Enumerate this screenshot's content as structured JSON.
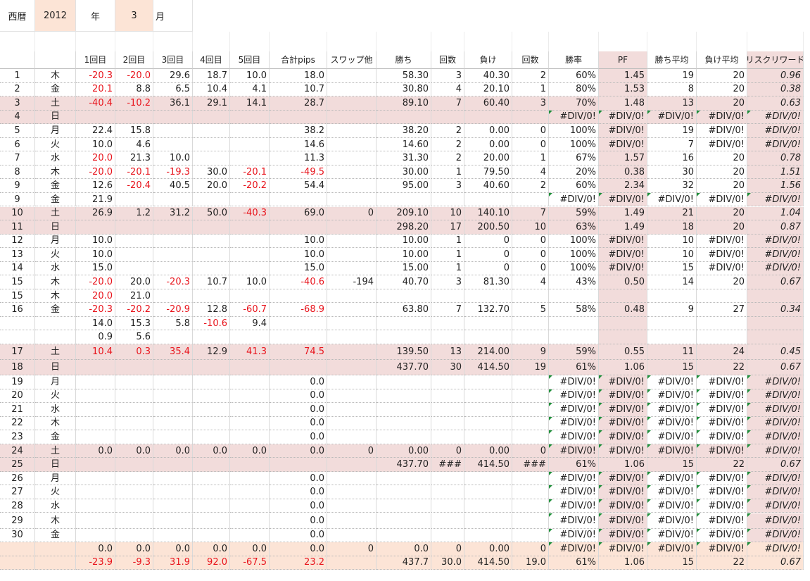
{
  "header": {
    "era_label": "西暦",
    "year": "2012",
    "year_unit": "年",
    "month": "3",
    "month_unit": "月"
  },
  "columns": [
    "",
    "",
    "1回目",
    "2回目",
    "3回目",
    "4回目",
    "5回目",
    "合計pips",
    "スワップ他",
    "勝ち",
    "回数",
    "負け",
    "回数",
    "勝率",
    "PF",
    "勝ち平均",
    "負け平均",
    "リスクリワード"
  ],
  "rows": [
    {
      "day": "1",
      "dow": "木",
      "t": [
        "-20.3",
        "-20.0",
        "29.6",
        "18.7",
        "10.0"
      ],
      "red": [
        0,
        1
      ],
      "sum": "18.0",
      "swap": "",
      "win": "58.30",
      "wc": "3",
      "loss": "40.30",
      "lc": "2",
      "rate": "60%",
      "pf": "1.45",
      "wavg": "19",
      "lavg": "20",
      "rr": "0.96"
    },
    {
      "day": "2",
      "dow": "金",
      "t": [
        "20.1",
        "8.8",
        "6.5",
        "10.4",
        "4.1"
      ],
      "red": [
        0
      ],
      "sum": "10.7",
      "swap": "",
      "win": "30.80",
      "wc": "4",
      "loss": "20.10",
      "lc": "1",
      "rate": "80%",
      "pf": "1.53",
      "wavg": "8",
      "lavg": "20",
      "rr": "0.38"
    },
    {
      "day": "3",
      "dow": "土",
      "shade": 1,
      "t": [
        "-40.4",
        "-10.2",
        "36.1",
        "29.1",
        "14.1"
      ],
      "red": [
        0,
        1
      ],
      "sum": "28.7",
      "swap": "",
      "win": "89.10",
      "wc": "7",
      "loss": "60.40",
      "lc": "3",
      "rate": "70%",
      "pf": "1.48",
      "wavg": "13",
      "lavg": "20",
      "rr": "0.63"
    },
    {
      "day": "4",
      "dow": "日",
      "shade": 1,
      "t": [
        "",
        "",
        "",
        "",
        ""
      ],
      "sum": "",
      "swap": "",
      "win": "",
      "wc": "",
      "loss": "",
      "lc": "",
      "rate": "#DIV/0!",
      "pf": "#DIV/0!",
      "wavg": "#DIV/0!",
      "lavg": "#DIV/0!",
      "rr": "#DIV/0!",
      "err": 1
    },
    {
      "day": "5",
      "dow": "月",
      "t": [
        "22.4",
        "15.8",
        "",
        "",
        ""
      ],
      "sum": "38.2",
      "swap": "",
      "win": "38.20",
      "wc": "2",
      "loss": "0.00",
      "lc": "0",
      "rate": "100%",
      "pf": "#DIV/0!",
      "wavg": "19",
      "lavg": "#DIV/0!",
      "rr": "#DIV/0!"
    },
    {
      "day": "6",
      "dow": "火",
      "t": [
        "10.0",
        "4.6",
        "",
        "",
        ""
      ],
      "sum": "14.6",
      "swap": "",
      "win": "14.60",
      "wc": "2",
      "loss": "0.00",
      "lc": "0",
      "rate": "100%",
      "pf": "#DIV/0!",
      "wavg": "7",
      "lavg": "#DIV/0!",
      "rr": "#DIV/0!"
    },
    {
      "day": "7",
      "dow": "水",
      "t": [
        "20.0",
        "21.3",
        "10.0",
        "",
        ""
      ],
      "red": [
        0
      ],
      "sum": "11.3",
      "swap": "",
      "win": "31.30",
      "wc": "2",
      "loss": "20.00",
      "lc": "1",
      "rate": "67%",
      "pf": "1.57",
      "wavg": "16",
      "lavg": "20",
      "rr": "0.78"
    },
    {
      "day": "8",
      "dow": "木",
      "t": [
        "-20.0",
        "-20.1",
        "-19.3",
        "30.0",
        "-20.1"
      ],
      "red": [
        0,
        1,
        2,
        4
      ],
      "sumred": 1,
      "sum": "-49.5",
      "swap": "",
      "win": "30.00",
      "wc": "1",
      "loss": "79.50",
      "lc": "4",
      "rate": "20%",
      "pf": "0.38",
      "wavg": "30",
      "lavg": "20",
      "rr": "1.51"
    },
    {
      "day": "9",
      "dow": "金",
      "t": [
        "12.6",
        "-20.4",
        "40.5",
        "20.0",
        "-20.2"
      ],
      "red": [
        1,
        4
      ],
      "sum": "54.4",
      "swap": "",
      "win": "95.00",
      "wc": "3",
      "loss": "40.60",
      "lc": "2",
      "rate": "60%",
      "pf": "2.34",
      "wavg": "32",
      "lavg": "20",
      "rr": "1.56"
    },
    {
      "day": "9",
      "dow": "金",
      "t": [
        "21.9",
        "",
        "",
        "",
        ""
      ],
      "sum": "",
      "swap": "",
      "win": "",
      "wc": "",
      "loss": "",
      "lc": "",
      "rate": "#DIV/0!",
      "pf": "#DIV/0!",
      "wavg": "#DIV/0!",
      "lavg": "#DIV/0!",
      "rr": "#DIV/0!",
      "err": 1
    },
    {
      "day": "10",
      "dow": "土",
      "shade": 1,
      "t": [
        "26.9",
        "1.2",
        "31.2",
        "50.0",
        "-40.3"
      ],
      "red": [
        4
      ],
      "sum": "69.0",
      "swap": "0",
      "win": "209.10",
      "wc": "10",
      "loss": "140.10",
      "lc": "7",
      "rate": "59%",
      "pf": "1.49",
      "wavg": "21",
      "lavg": "20",
      "rr": "1.04"
    },
    {
      "day": "11",
      "dow": "日",
      "shade": 1,
      "t": [
        "",
        "",
        "",
        "",
        ""
      ],
      "sum": "",
      "swap": "",
      "win": "298.20",
      "wc": "17",
      "loss": "200.50",
      "lc": "10",
      "rate": "63%",
      "pf": "1.49",
      "wavg": "18",
      "lavg": "20",
      "rr": "0.87"
    },
    {
      "day": "12",
      "dow": "月",
      "t": [
        "10.0",
        "",
        "",
        "",
        ""
      ],
      "sum": "10.0",
      "swap": "",
      "win": "10.00",
      "wc": "1",
      "loss": "0",
      "lc": "0",
      "rate": "100%",
      "pf": "#DIV/0!",
      "wavg": "10",
      "lavg": "#DIV/0!",
      "rr": "#DIV/0!"
    },
    {
      "day": "13",
      "dow": "火",
      "t": [
        "10.0",
        "",
        "",
        "",
        ""
      ],
      "sum": "10.0",
      "swap": "",
      "win": "10.00",
      "wc": "1",
      "loss": "0",
      "lc": "0",
      "rate": "100%",
      "pf": "#DIV/0!",
      "wavg": "10",
      "lavg": "#DIV/0!",
      "rr": "#DIV/0!"
    },
    {
      "day": "14",
      "dow": "水",
      "t": [
        "15.0",
        "",
        "",
        "",
        ""
      ],
      "sum": "15.0",
      "swap": "",
      "win": "15.00",
      "wc": "1",
      "loss": "0",
      "lc": "0",
      "rate": "100%",
      "pf": "#DIV/0!",
      "wavg": "15",
      "lavg": "#DIV/0!",
      "rr": "#DIV/0!"
    },
    {
      "day": "15",
      "dow": "木",
      "t": [
        "-20.0",
        "20.0",
        "-20.3",
        "10.7",
        "10.0"
      ],
      "red": [
        0,
        2
      ],
      "sumred": 1,
      "sum": "-40.6",
      "swap": "-194",
      "win": "40.70",
      "wc": "3",
      "loss": "81.30",
      "lc": "4",
      "rate": "43%",
      "pf": "0.50",
      "wavg": "14",
      "lavg": "20",
      "rr": "0.67"
    },
    {
      "day": "15",
      "dow": "木",
      "t": [
        "20.0",
        "21.0",
        "",
        "",
        ""
      ],
      "red": [
        0
      ],
      "sum": "",
      "swap": "",
      "win": "",
      "wc": "",
      "loss": "",
      "lc": "",
      "rate": "",
      "pf": "",
      "wavg": "",
      "lavg": "",
      "rr": ""
    },
    {
      "day": "16",
      "dow": "金",
      "t": [
        "-20.3",
        "-20.2",
        "-20.9",
        "12.8",
        "-60.7"
      ],
      "red": [
        0,
        1,
        2,
        4
      ],
      "sumred": 1,
      "sum": "-68.9",
      "swap": "",
      "win": "63.80",
      "wc": "7",
      "loss": "132.70",
      "lc": "5",
      "rate": "58%",
      "pf": "0.48",
      "wavg": "9",
      "lavg": "27",
      "rr": "0.34"
    },
    {
      "day": "",
      "dow": "",
      "t": [
        "14.0",
        "15.3",
        "5.8",
        "-10.6",
        "9.4"
      ],
      "red": [
        3
      ],
      "sum": "",
      "swap": "",
      "win": "",
      "wc": "",
      "loss": "",
      "lc": "",
      "rate": "",
      "pf": "",
      "wavg": "",
      "lavg": "",
      "rr": ""
    },
    {
      "day": "",
      "dow": "",
      "t": [
        "0.9",
        "5.6",
        "",
        "",
        ""
      ],
      "sum": "",
      "swap": "",
      "win": "",
      "wc": "",
      "loss": "",
      "lc": "",
      "rate": "",
      "pf": "",
      "wavg": "",
      "lavg": "",
      "rr": ""
    },
    {
      "day": "17",
      "dow": "土",
      "shade": 1,
      "tall": 1,
      "t": [
        "10.4",
        "0.3",
        "35.4",
        "12.9",
        "41.3"
      ],
      "red": [
        0,
        1,
        2,
        4
      ],
      "sumred": 1,
      "sum": "74.5",
      "swap": "",
      "win": "139.50",
      "wc": "13",
      "loss": "214.00",
      "lc": "9",
      "rate": "59%",
      "pf": "0.55",
      "wavg": "11",
      "lavg": "24",
      "rr": "0.45"
    },
    {
      "day": "18",
      "dow": "日",
      "shade": 1,
      "tall": 1,
      "t": [
        "",
        "",
        "",
        "",
        ""
      ],
      "sum": "",
      "swap": "",
      "win": "437.70",
      "wc": "30",
      "loss": "414.50",
      "lc": "19",
      "rate": "61%",
      "pf": "1.06",
      "wavg": "15",
      "lavg": "22",
      "rr": "0.67"
    },
    {
      "day": "19",
      "dow": "月",
      "t": [
        "",
        "",
        "",
        "",
        ""
      ],
      "sum": "0.0",
      "swap": "",
      "win": "",
      "wc": "",
      "loss": "",
      "lc": "",
      "rate": "#DIV/0!",
      "pf": "#DIV/0!",
      "wavg": "#DIV/0!",
      "lavg": "#DIV/0!",
      "rr": "#DIV/0!",
      "err": 1
    },
    {
      "day": "20",
      "dow": "火",
      "t": [
        "",
        "",
        "",
        "",
        ""
      ],
      "sum": "0.0",
      "swap": "",
      "win": "",
      "wc": "",
      "loss": "",
      "lc": "",
      "rate": "#DIV/0!",
      "pf": "#DIV/0!",
      "wavg": "#DIV/0!",
      "lavg": "#DIV/0!",
      "rr": "#DIV/0!",
      "err": 1
    },
    {
      "day": "21",
      "dow": "水",
      "t": [
        "",
        "",
        "",
        "",
        ""
      ],
      "sum": "0.0",
      "swap": "",
      "win": "",
      "wc": "",
      "loss": "",
      "lc": "",
      "rate": "#DIV/0!",
      "pf": "#DIV/0!",
      "wavg": "#DIV/0!",
      "lavg": "#DIV/0!",
      "rr": "#DIV/0!",
      "err": 1
    },
    {
      "day": "22",
      "dow": "木",
      "t": [
        "",
        "",
        "",
        "",
        ""
      ],
      "sum": "0.0",
      "swap": "",
      "win": "",
      "wc": "",
      "loss": "",
      "lc": "",
      "rate": "#DIV/0!",
      "pf": "#DIV/0!",
      "wavg": "#DIV/0!",
      "lavg": "#DIV/0!",
      "rr": "#DIV/0!",
      "err": 1
    },
    {
      "day": "23",
      "dow": "金",
      "t": [
        "",
        "",
        "",
        "",
        ""
      ],
      "sum": "0.0",
      "swap": "",
      "win": "",
      "wc": "",
      "loss": "",
      "lc": "",
      "rate": "#DIV/0!",
      "pf": "#DIV/0!",
      "wavg": "#DIV/0!",
      "lavg": "#DIV/0!",
      "rr": "#DIV/0!",
      "err": 1
    },
    {
      "day": "24",
      "dow": "土",
      "shade": 1,
      "t": [
        "0.0",
        "0.0",
        "0.0",
        "0.0",
        "0.0"
      ],
      "sum": "0.0",
      "swap": "0",
      "win": "0.00",
      "wc": "0",
      "loss": "0.00",
      "lc": "0",
      "rate": "#DIV/0!",
      "pf": "#DIV/0!",
      "wavg": "#DIV/0!",
      "lavg": "#DIV/0!",
      "rr": "#DIV/0!",
      "err": 1
    },
    {
      "day": "25",
      "dow": "日",
      "shade": 1,
      "t": [
        "",
        "",
        "",
        "",
        ""
      ],
      "sum": "",
      "swap": "",
      "win": "437.70",
      "wc": "###",
      "loss": "414.50",
      "lc": "###",
      "rate": "61%",
      "pf": "1.06",
      "wavg": "15",
      "lavg": "22",
      "rr": "0.67"
    },
    {
      "day": "26",
      "dow": "月",
      "t": [
        "",
        "",
        "",
        "",
        ""
      ],
      "sum": "0.0",
      "swap": "",
      "win": "",
      "wc": "",
      "loss": "",
      "lc": "",
      "rate": "#DIV/0!",
      "pf": "#DIV/0!",
      "wavg": "#DIV/0!",
      "lavg": "#DIV/0!",
      "rr": "#DIV/0!",
      "err": 1
    },
    {
      "day": "27",
      "dow": "火",
      "t": [
        "",
        "",
        "",
        "",
        ""
      ],
      "sum": "0.0",
      "swap": "",
      "win": "",
      "wc": "",
      "loss": "",
      "lc": "",
      "rate": "#DIV/0!",
      "pf": "#DIV/0!",
      "wavg": "#DIV/0!",
      "lavg": "#DIV/0!",
      "rr": "#DIV/0!",
      "err": 1
    },
    {
      "day": "28",
      "dow": "水",
      "t": [
        "",
        "",
        "",
        "",
        ""
      ],
      "sum": "0.0",
      "swap": "",
      "win": "",
      "wc": "",
      "loss": "",
      "lc": "",
      "rate": "#DIV/0!",
      "pf": "#DIV/0!",
      "wavg": "#DIV/0!",
      "lavg": "#DIV/0!",
      "rr": "#DIV/0!",
      "err": 1
    },
    {
      "day": "29",
      "dow": "木",
      "tall": 1,
      "t": [
        "",
        "",
        "",
        "",
        ""
      ],
      "sum": "0.0",
      "swap": "",
      "win": "",
      "wc": "",
      "loss": "",
      "lc": "",
      "rate": "#DIV/0!",
      "pf": "#DIV/0!",
      "wavg": "#DIV/0!",
      "lavg": "#DIV/0!",
      "rr": "#DIV/0!",
      "err": 1
    },
    {
      "day": "30",
      "dow": "金",
      "t": [
        "",
        "",
        "",
        "",
        ""
      ],
      "sum": "0.0",
      "swap": "",
      "win": "",
      "wc": "",
      "loss": "",
      "lc": "",
      "rate": "#DIV/0!",
      "pf": "#DIV/0!",
      "wavg": "#DIV/0!",
      "lavg": "#DIV/0!",
      "rr": "#DIV/0!",
      "err": 1
    },
    {
      "day": "",
      "dow": "",
      "peach": 1,
      "t": [
        "0.0",
        "0.0",
        "0.0",
        "0.0",
        "0.0"
      ],
      "sum": "0.0",
      "swap": "0",
      "win": "0.0",
      "wc": "0",
      "loss": "0.00",
      "lc": "0",
      "rate": "#DIV/0!",
      "pf": "#DIV/0!",
      "wavg": "#DIV/0!",
      "lavg": "#DIV/0!",
      "rr": "#DIV/0!",
      "err": 1
    },
    {
      "day": "",
      "dow": "",
      "peach": 1,
      "t": [
        "-23.9",
        "-9.3",
        "31.9",
        "92.0",
        "-67.5"
      ],
      "red": [
        0,
        1,
        2,
        3,
        4
      ],
      "sumred": 1,
      "sum": "23.2",
      "swap": "",
      "win": "437.7",
      "wc": "30.0",
      "loss": "414.50",
      "lc": "19.0",
      "rate": "61%",
      "pf": "1.06",
      "wavg": "15",
      "lavg": "22",
      "rr": "0.67"
    }
  ],
  "colors": {
    "pink_row": "#f2dcdb",
    "peach_cell": "#fce4d6",
    "negative_text": "#e8141c",
    "error_marker": "#1f8f3a"
  }
}
